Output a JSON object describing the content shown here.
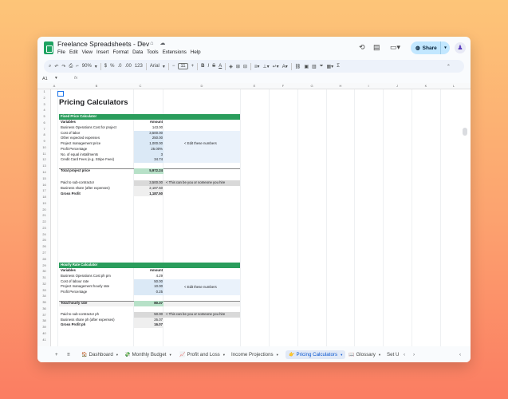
{
  "window": {
    "title": "Freelance Spreadsheets - Dev",
    "title_icons": "☆ ⌂ ☁",
    "menus": [
      "File",
      "Edit",
      "View",
      "Insert",
      "Format",
      "Data",
      "Tools",
      "Extensions",
      "Help"
    ],
    "share_label": "Share",
    "avatar_glyph": "♟"
  },
  "toolbar": {
    "zoom": "90%",
    "currency": "$",
    "percent": "%",
    "dec_less": ".0",
    "dec_more": ".00",
    "number_format": "123",
    "font": "Arial",
    "font_size": "11",
    "bold": "B",
    "italic": "I",
    "strike": "S",
    "sum": "Σ"
  },
  "formula_bar": {
    "cell_ref": "A1",
    "fx": "fx"
  },
  "columns": [
    "A",
    "B",
    "C",
    "D",
    "E",
    "F",
    "G",
    "H",
    "I",
    "J",
    "K",
    "L"
  ],
  "page_title": "Pricing Calculators",
  "fixed": {
    "header": "Fixed Price Calculator",
    "col_variables": "Variables",
    "col_amount": "Amount",
    "rows": [
      {
        "label": "Business Operations Cost for project",
        "value": "143.00"
      },
      {
        "label": "Cost of labor",
        "value": "3,500.00"
      },
      {
        "label": "Other expected expenses",
        "value": "250.00"
      },
      {
        "label": "Project management price",
        "value": "1,000.00"
      },
      {
        "label": "Profit Percentage",
        "value": "25.00%"
      },
      {
        "label": "No. of equal installments",
        "value": "3"
      },
      {
        "label": "Credit Card Fees (e.g. Stripe Fees)",
        "value": "34.74"
      }
    ],
    "total_label": "Total project price",
    "total_value": "5,972.24",
    "edit_note": "< Edit these numbers",
    "sub_label": "Paid to sub-contractor",
    "sub_value": "3,500.00",
    "sub_note": "< This can be you or someone you hire",
    "share_label": "Business share (after expenses)",
    "share_value": "2,187.50",
    "gross_label": "Gross Profit",
    "gross_value": "1,187.50"
  },
  "hourly": {
    "header": "Hourly Rate Calculator",
    "col_variables": "Variables",
    "col_amount": "Amount",
    "rows": [
      {
        "label": "Business Operations Cost ph pm",
        "value": "4.29"
      },
      {
        "label": "Cost of labour rate",
        "value": "50.00"
      },
      {
        "label": "Project management hourly rate",
        "value": "10.00"
      },
      {
        "label": "Profit Percentage",
        "value": "0.25"
      }
    ],
    "total_label": "Total hourly rate",
    "total_value": "80.37",
    "edit_note": "< Edit these numbers",
    "sub_label": "Paid to sub-contractor ph",
    "sub_value": "50.00",
    "sub_note": "< This can be you or someone you hire",
    "share_label": "Business share ph (after expenses)",
    "share_value": "26.07",
    "gross_label": "Gross Profit ph",
    "gross_value": "16.07"
  },
  "tabs": [
    {
      "label": "Dashboard",
      "icon": "🏠"
    },
    {
      "label": "Monthly Budget",
      "icon": "💸"
    },
    {
      "label": "Profit and Loss",
      "icon": "📈"
    },
    {
      "label": "Income Projections",
      "icon": ""
    },
    {
      "label": "Pricing Calculators",
      "icon": "👉"
    },
    {
      "label": "Glossary",
      "icon": "📖"
    },
    {
      "label": "Set U",
      "icon": ""
    }
  ],
  "colors": {
    "green_header": "#2a9d5c",
    "input_blue": "#dbe9f6",
    "total_green": "#b7e1c8",
    "grey_cell": "#d9d9d9",
    "accent": "#0b57d0"
  }
}
